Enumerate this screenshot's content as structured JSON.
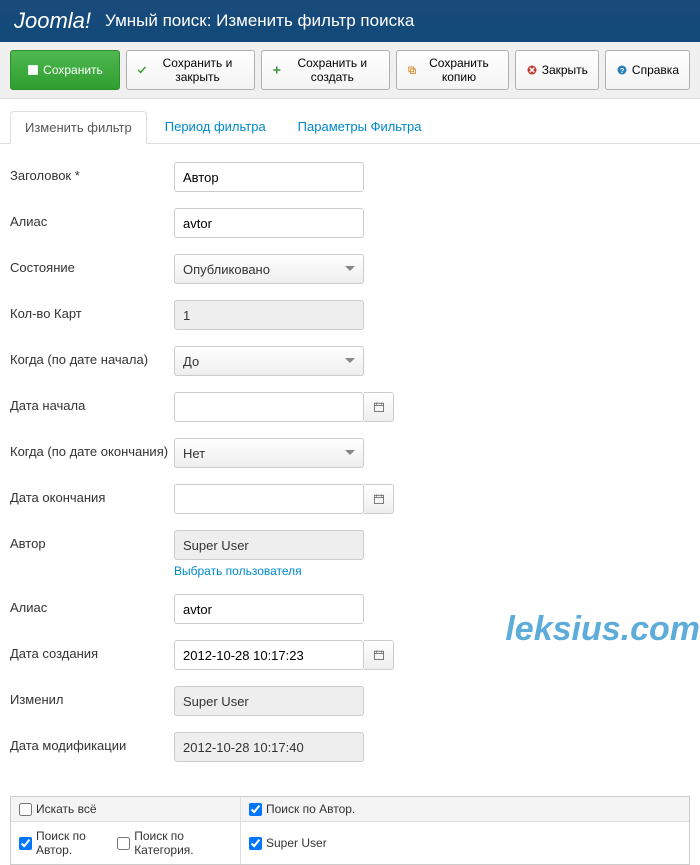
{
  "header": {
    "brand": "Joomla!",
    "title": "Умный поиск: Изменить фильтр поиска"
  },
  "toolbar": {
    "save": "Сохранить",
    "save_close": "Сохранить и закрыть",
    "save_new": "Сохранить и создать",
    "save_copy": "Сохранить копию",
    "close": "Закрыть",
    "help": "Справка"
  },
  "tabs": {
    "edit": "Изменить фильтр",
    "period": "Период фильтра",
    "params": "Параметры Фильтра"
  },
  "fields": {
    "title_label": "Заголовок *",
    "title_value": "Автор",
    "alias_label": "Алиас",
    "alias_value": "avtor",
    "state_label": "Состояние",
    "state_value": "Опубликовано",
    "mapcount_label": "Кол-во Карт",
    "mapcount_value": "1",
    "whenstart_label": "Когда (по дате начала)",
    "whenstart_value": "До",
    "datestart_label": "Дата начала",
    "datestart_value": "",
    "whenend_label": "Когда (по дате окончания)",
    "whenend_value": "Нет",
    "dateend_label": "Дата окончания",
    "dateend_value": "",
    "author_label": "Автор",
    "author_value": "Super User",
    "author_link": "Выбрать пользователя",
    "alias2_label": "Алиас",
    "alias2_value": "avtor",
    "created_label": "Дата создания",
    "created_value": "2012-10-28 10:17:23",
    "modifiedby_label": "Изменил",
    "modifiedby_value": "Super User",
    "modified_label": "Дата модификации",
    "modified_value": "2012-10-28 10:17:40"
  },
  "grid": {
    "search_all": "Искать всё",
    "by_author_head": "Поиск по Автор.",
    "by_author": "Поиск по Автор.",
    "by_category": "Поиск по Категория.",
    "super_user": "Super User"
  },
  "watermark": "leksius.com"
}
